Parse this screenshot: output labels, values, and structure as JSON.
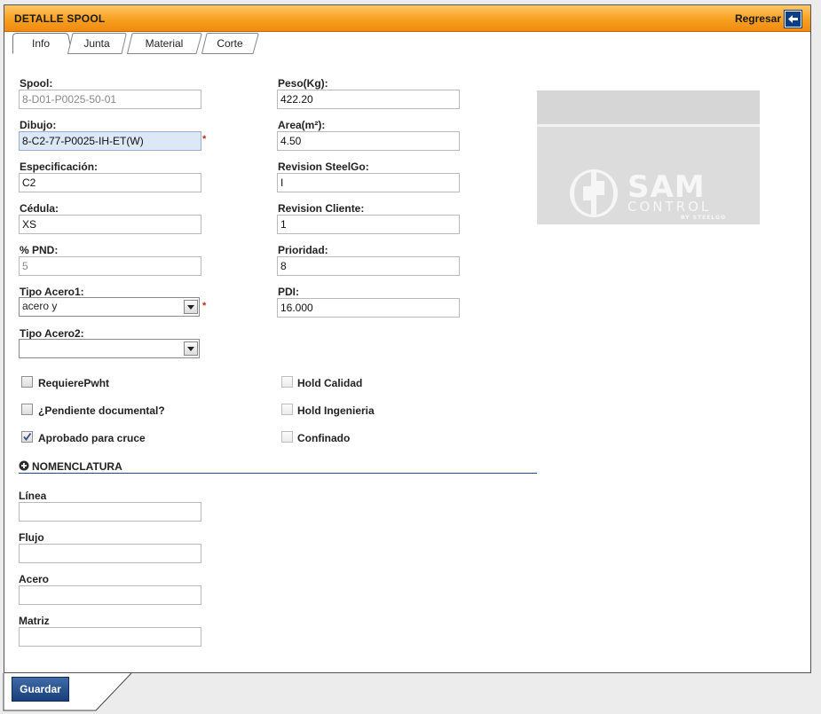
{
  "header": {
    "title": "DETALLE SPOOL",
    "back_label": "Regresar"
  },
  "tabs": [
    {
      "label": "Info",
      "active": true
    },
    {
      "label": "Junta",
      "active": false
    },
    {
      "label": "Material",
      "active": false
    },
    {
      "label": "Corte",
      "active": false
    }
  ],
  "left_fields": {
    "spool": {
      "label": "Spool:",
      "value": "8-D01-P0025-50-01"
    },
    "dibujo": {
      "label": "Dibujo:",
      "value": "8-C2-77-P0025-IH-ET(W)"
    },
    "especificacion": {
      "label": "Especificación:",
      "value": "C2"
    },
    "cedula": {
      "label": "Cédula:",
      "value": "XS"
    },
    "pnd": {
      "label": "% PND:",
      "value": "5"
    },
    "tipo_acero1": {
      "label": "Tipo Acero1:",
      "value": "acero y"
    },
    "tipo_acero2": {
      "label": "Tipo Acero2:",
      "value": ""
    }
  },
  "right_fields": {
    "peso": {
      "label": "Peso(Kg):",
      "value": "422.20"
    },
    "area": {
      "label": "Area(m²):",
      "value": "4.50"
    },
    "revision_steelgo": {
      "label": "Revision SteelGo:",
      "value": "I"
    },
    "revision_cliente": {
      "label": "Revision Cliente:",
      "value": "1"
    },
    "prioridad": {
      "label": "Prioridad:",
      "value": "8"
    },
    "pdi": {
      "label": "PDI:",
      "value": "16.000"
    }
  },
  "required_mark": "*",
  "checkboxes": {
    "requiere_pwht": {
      "label": "RequierePwht",
      "checked": false
    },
    "pendiente_documental": {
      "label": "¿Pendiente documental?",
      "checked": false
    },
    "aprobado_cruce": {
      "label": "Aprobado para cruce",
      "checked": true
    },
    "hold_calidad": {
      "label": "Hold Calidad",
      "checked": false
    },
    "hold_ingenieria": {
      "label": "Hold Ingenieria",
      "checked": false
    },
    "confinado": {
      "label": "Confinado",
      "checked": false
    }
  },
  "logo": {
    "text_main": "SAM",
    "text_sub": "CONTROL",
    "text_by": "BY STEELGO"
  },
  "nomenclatura": {
    "title": "NOMENCLATURA",
    "fields": {
      "linea": {
        "label": "Línea",
        "value": ""
      },
      "flujo": {
        "label": "Flujo",
        "value": ""
      },
      "acero": {
        "label": "Acero",
        "value": ""
      },
      "matriz": {
        "label": "Matriz",
        "value": ""
      }
    }
  },
  "footer": {
    "save_label": "Guardar"
  },
  "colors": {
    "header_orange": "#f8a020",
    "primary_blue": "#173f7c",
    "required_red": "#c0241c"
  }
}
